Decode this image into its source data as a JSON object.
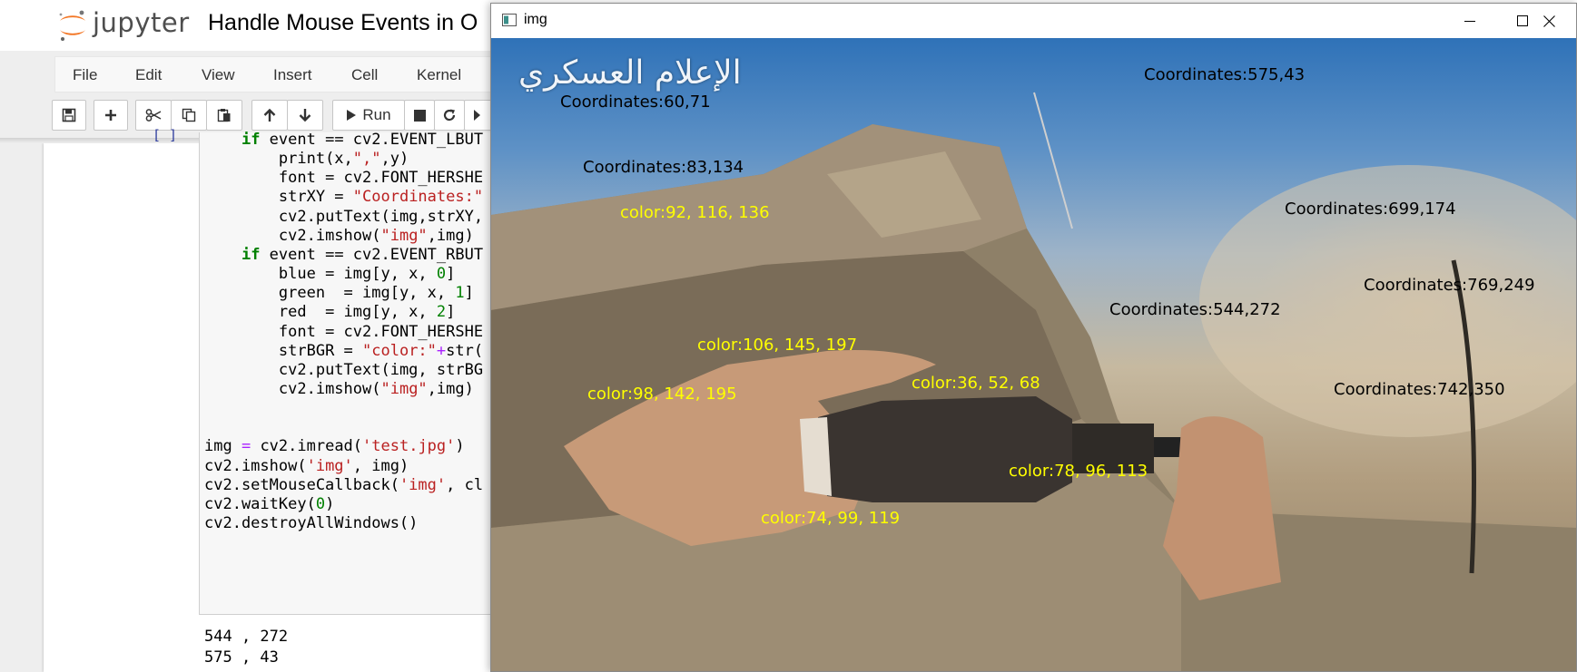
{
  "notebook": {
    "brand": "jupyter",
    "title": "Handle Mouse Events in O",
    "menu": [
      "File",
      "Edit",
      "View",
      "Insert",
      "Cell",
      "Kernel"
    ],
    "toolbar": {
      "run_label": "Run"
    },
    "prompt": "[ ]",
    "code_lines": [
      {
        "indent": "    ",
        "parts": [
          [
            "kw",
            "if"
          ],
          [
            "",
            " event == cv2.EVENT_LBUT"
          ]
        ]
      },
      {
        "indent": "        ",
        "parts": [
          [
            "",
            "print(x,"
          ],
          [
            "str",
            "\",\""
          ],
          [
            "",
            ",y)"
          ]
        ]
      },
      {
        "indent": "        ",
        "parts": [
          [
            "",
            "font = cv2.FONT_HERSHE"
          ]
        ]
      },
      {
        "indent": "        ",
        "parts": [
          [
            "",
            "strXY = "
          ],
          [
            "str",
            "\"Coordinates:\""
          ]
        ]
      },
      {
        "indent": "        ",
        "parts": [
          [
            "",
            "cv2.putText(img,strXY,"
          ]
        ]
      },
      {
        "indent": "        ",
        "parts": [
          [
            "",
            "cv2.imshow("
          ],
          [
            "str",
            "\"img\""
          ],
          [
            "",
            ",img)"
          ]
        ]
      },
      {
        "indent": "    ",
        "parts": [
          [
            "kw",
            "if"
          ],
          [
            "",
            " event == cv2.EVENT_RBUT"
          ]
        ]
      },
      {
        "indent": "        ",
        "parts": [
          [
            "",
            "blue = img[y, x, "
          ],
          [
            "num",
            "0"
          ],
          [
            "",
            "]"
          ]
        ]
      },
      {
        "indent": "        ",
        "parts": [
          [
            "",
            "green  = img[y, x, "
          ],
          [
            "num",
            "1"
          ],
          [
            "",
            "]"
          ]
        ]
      },
      {
        "indent": "        ",
        "parts": [
          [
            "",
            "red  = img[y, x, "
          ],
          [
            "num",
            "2"
          ],
          [
            "",
            "]"
          ]
        ]
      },
      {
        "indent": "        ",
        "parts": [
          [
            "",
            "font = cv2.FONT_HERSHE"
          ]
        ]
      },
      {
        "indent": "        ",
        "parts": [
          [
            "",
            "strBGR = "
          ],
          [
            "str",
            "\"color:\""
          ],
          [
            "op",
            "+"
          ],
          [
            "",
            "str("
          ]
        ]
      },
      {
        "indent": "        ",
        "parts": [
          [
            "",
            "cv2.putText(img, strBG"
          ]
        ]
      },
      {
        "indent": "        ",
        "parts": [
          [
            "",
            "cv2.imshow("
          ],
          [
            "str",
            "\"img\""
          ],
          [
            "",
            ",img)"
          ]
        ]
      },
      {
        "indent": "",
        "parts": [
          [
            "",
            ""
          ]
        ]
      },
      {
        "indent": "",
        "parts": [
          [
            "",
            ""
          ]
        ]
      },
      {
        "indent": "",
        "parts": [
          [
            "",
            "img "
          ],
          [
            "op",
            "="
          ],
          [
            "",
            " cv2.imread("
          ],
          [
            "str",
            "'test.jpg'"
          ],
          [
            "",
            ")"
          ]
        ]
      },
      {
        "indent": "",
        "parts": [
          [
            "",
            "cv2.imshow("
          ],
          [
            "str",
            "'img'"
          ],
          [
            "",
            ", img)"
          ]
        ]
      },
      {
        "indent": "",
        "parts": [
          [
            "",
            "cv2.setMouseCallback("
          ],
          [
            "str",
            "'img'"
          ],
          [
            "",
            ", cl"
          ]
        ]
      },
      {
        "indent": "",
        "parts": [
          [
            "",
            "cv2.waitKey("
          ],
          [
            "num",
            "0"
          ],
          [
            "",
            ")"
          ]
        ]
      },
      {
        "indent": "",
        "parts": [
          [
            "",
            "cv2.destroyAllWindows()"
          ]
        ]
      }
    ],
    "output_lines": [
      "544 , 272",
      "575 , 43"
    ]
  },
  "image_window": {
    "title": "img",
    "controls": [
      "minimize",
      "maximize",
      "close"
    ],
    "watermark": "الإعلام العسكري",
    "coordinate_labels": [
      "Coordinates:60,71",
      "Coordinates:575,43",
      "Coordinates:83,134",
      "Coordinates:699,174",
      "Coordinates:769,249",
      "Coordinates:544,272",
      "Coordinates:742,350"
    ],
    "color_labels": [
      "color:92, 116, 136",
      "color:106, 145, 197",
      "color:98, 142, 195",
      "color:36, 52, 68",
      "color:78, 96, 113",
      "color:74, 99, 119"
    ]
  },
  "colors": {
    "jupyter_orange": "#f37726",
    "coord_text": "#000000",
    "color_text": "#ffff00"
  }
}
